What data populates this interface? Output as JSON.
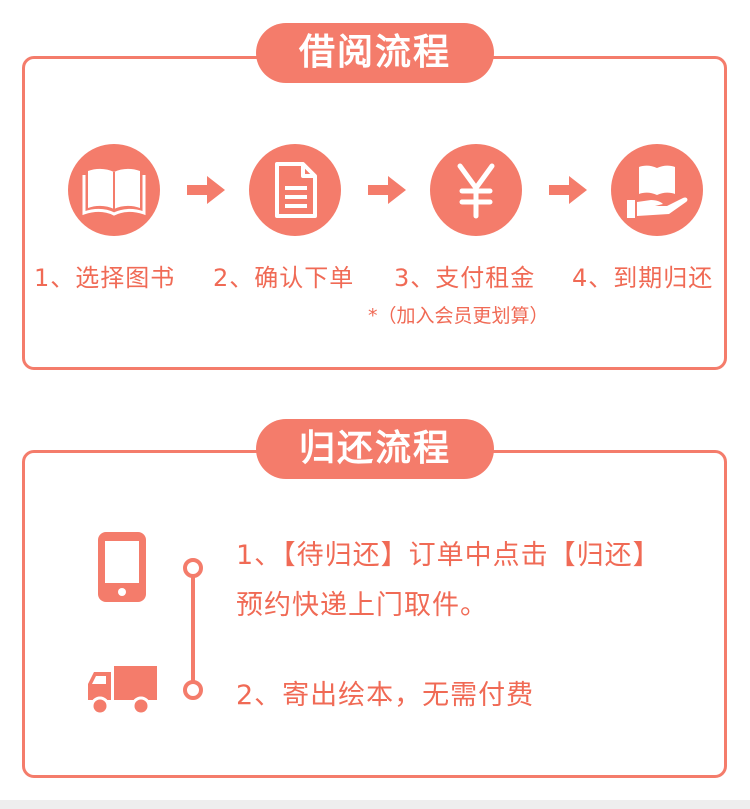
{
  "borrow": {
    "title": "借阅流程",
    "steps": [
      {
        "label": "1、选择图书",
        "icon": "open-book-icon"
      },
      {
        "label": "2、确认下单",
        "icon": "document-icon"
      },
      {
        "label": "3、支付租金",
        "icon": "yen-icon"
      },
      {
        "label": "4、到期归还",
        "icon": "hand-book-icon"
      }
    ],
    "note": "*（加入会员更划算）"
  },
  "return": {
    "title": "归还流程",
    "step1_line1": "1、【待归还】订单中点击【归还】",
    "step1_line2": "预约快递上门取件。",
    "step2": "2、寄出绘本，无需付费"
  },
  "colors": {
    "accent": "#f47c6b",
    "text": "#f06a55"
  }
}
